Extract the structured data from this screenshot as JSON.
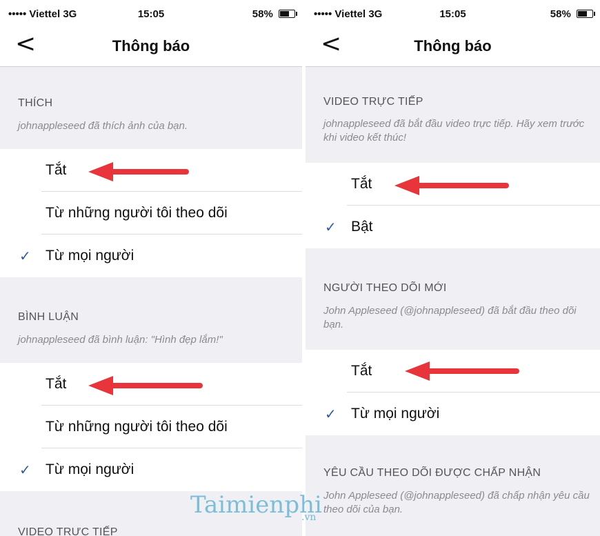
{
  "status": {
    "carrier": "••••• Viettel  3G",
    "time": "15:05",
    "battery": "58%"
  },
  "nav": {
    "back_icon": "<",
    "title": "Thông báo"
  },
  "left": {
    "likes": {
      "title": "THÍCH",
      "desc": "johnappleseed đã thích ảnh của bạn."
    },
    "likes_options": [
      "Tắt",
      "Từ những người tôi theo dõi",
      "Từ mọi người"
    ],
    "comments": {
      "title": "BÌNH LUẬN",
      "desc": "johnappleseed đã bình luận: \"Hình đẹp lắm!\""
    },
    "comments_options": [
      "Tắt",
      "Từ những người tôi theo dõi",
      "Từ mọi người"
    ],
    "live_title": "VIDEO TRỰC TIẾP"
  },
  "right": {
    "live": {
      "title": "VIDEO TRỰC TIẾP",
      "desc": "johnappleseed đã bắt đầu video trực tiếp. Hãy xem trước khi video kết thúc!"
    },
    "live_options": [
      "Tắt",
      "Bật"
    ],
    "followers": {
      "title": "NGƯỜI THEO DÕI MỚI",
      "desc": "John Appleseed (@johnappleseed) đã bắt đầu theo dõi bạn."
    },
    "followers_options": [
      "Tắt",
      "Từ mọi người"
    ],
    "accepted": {
      "title": "YÊU CẦU THEO DÕI ĐƯỢC CHẤP NHẬN",
      "desc": "John Appleseed (@johnappleseed) đã chấp nhận yêu cầu theo dõi của bạn."
    }
  },
  "check_icon": "✓",
  "watermark": {
    "main": "Taimienphi",
    "sub": ".vn"
  },
  "colors": {
    "arrow": "#e8353b",
    "check": "#2f5b9f",
    "background": "#efeff4"
  }
}
